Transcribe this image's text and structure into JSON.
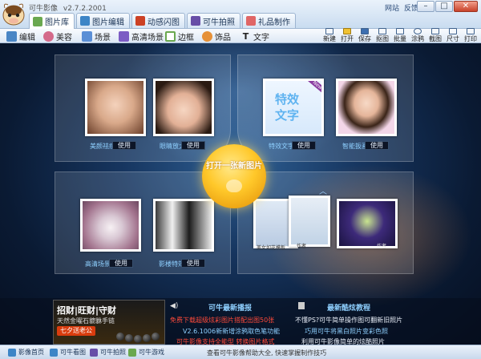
{
  "window": {
    "app_name": "可牛影像",
    "version": "v2.7.2.2001",
    "links": [
      "网站",
      "反馈意见"
    ]
  },
  "tabs": [
    {
      "label": "图片库",
      "color": "#6aa84f"
    },
    {
      "label": "图片编辑",
      "color": "#3d85c6"
    },
    {
      "label": "动感闪图",
      "color": "#cc4125"
    },
    {
      "label": "可牛拍照",
      "color": "#674ea7"
    },
    {
      "label": "礼品制作",
      "color": "#e06666"
    }
  ],
  "toolbar": {
    "tools": [
      {
        "label": "编辑",
        "icon": "edit-icon",
        "color": "#4a86c5"
      },
      {
        "label": "美容",
        "icon": "beauty-icon",
        "color": "#d46a8a"
      },
      {
        "label": "场景",
        "icon": "scene-icon",
        "color": "#5b8fd6"
      },
      {
        "label": "高清场景",
        "icon": "hd-scene-icon",
        "color": "#7c5cc4"
      },
      {
        "label": "边框",
        "icon": "frame-icon",
        "color": "#6aa84f"
      },
      {
        "label": "饰品",
        "icon": "ornament-icon",
        "color": "#e69138"
      },
      {
        "label": "文字",
        "icon": "text-icon",
        "color": "#333333"
      }
    ],
    "actions": [
      "新建",
      "打开",
      "保存",
      "抠图",
      "批量",
      "涂鸦",
      "截图",
      "尺寸",
      "打印"
    ]
  },
  "features": [
    {
      "label": "美颜祛痘",
      "use": "使用"
    },
    {
      "label": "眼睛放大",
      "use": "使用"
    },
    {
      "label": "特效文字",
      "use": "使用"
    },
    {
      "label": "智能扳画",
      "use": "使用"
    },
    {
      "label": "高清场景",
      "use": "使用"
    },
    {
      "label": "影楼特效",
      "use": "使用"
    },
    {
      "label": "美女如花模板",
      "use": "使用"
    },
    {
      "label": "作者",
      "use": "使用"
    },
    {
      "label": "作者",
      "use": "使用"
    }
  ],
  "thumb_text": {
    "effect_word_1": "特效",
    "effect_word_2": "文字",
    "new_badge": "New"
  },
  "center_button": {
    "label": "打开一张新图片",
    "color": "#ffc82a"
  },
  "ad": {
    "headline": "招财|旺财|守财",
    "sub": "天然金曜石貔貅手链",
    "cta": "七夕送老公"
  },
  "news": {
    "left_title": "可牛最新播报",
    "left_lines": [
      "免费下载超级炫彩图片搭配出图50张",
      "V2.6.1006新新增涂鸦取色笔功能",
      "可牛影像支持全能型 转换图片格式"
    ],
    "right_title": "最新酷炫教程",
    "right_lines": [
      "不懂PS?可牛简单操作图可翻新旧照片",
      "巧用可牛将黑白照片变彩色照",
      "利用可牛影像简单的炫酷照片"
    ]
  },
  "statusbar": {
    "items": [
      {
        "label": "影像首页",
        "color": "#3d85c6"
      },
      {
        "label": "可牛看图",
        "color": "#3d85c6"
      },
      {
        "label": "可牛拍照",
        "color": "#674ea7"
      },
      {
        "label": "可牛游戏",
        "color": "#6aa84f"
      }
    ],
    "message": "查看可牛影像帮助大全, 快速掌握制作技巧"
  }
}
